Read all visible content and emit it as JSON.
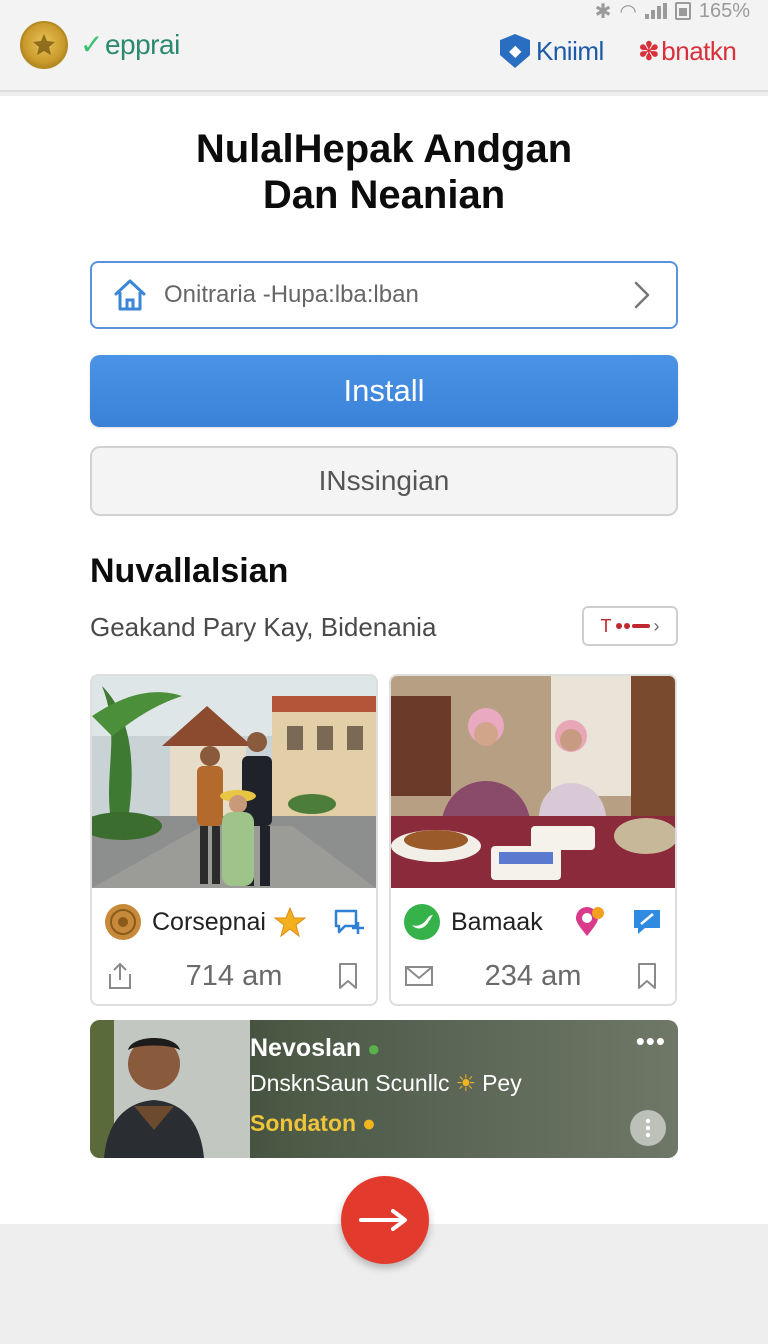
{
  "status_bar": {
    "battery_text": "165%"
  },
  "header": {
    "brand_left": "epprai",
    "brand_right_1": "Kniiml",
    "brand_right_2": "bnatkn"
  },
  "main": {
    "title_line1": "NulalHepak Andgan",
    "title_line2": "Dan Neanian",
    "picker_value": "Onitraria -Hupa:lba:lban",
    "primary_button": "Install",
    "secondary_button": "INssingian",
    "section_title": "Nuvallalsian",
    "subline": "Geakand Pary Kay, Bidenania",
    "tag_text": "T"
  },
  "posts": [
    {
      "name": "Corsepnai",
      "time": "714 am",
      "avatar_icon": "gold-medallion-icon",
      "badge_icon": "star-icon",
      "action_icon": "message-plus-icon",
      "footer_left_icon": "share-icon",
      "footer_right_icon": "bookmark-icon"
    },
    {
      "name": "Bamaak",
      "time": "234 am",
      "avatar_icon": "bird-logo-icon",
      "badge_icon": "location-pin-icon",
      "action_icon": "edit-message-icon",
      "footer_left_icon": "mail-icon",
      "footer_right_icon": "bookmark-icon"
    }
  ],
  "banner": {
    "title": "Nevoslan",
    "subtitle_part1": "DnsknSaun Scunllc",
    "subtitle_part2": "Pey",
    "cta": "Sondaton"
  },
  "colors": {
    "primary": "#3a82d8",
    "fab": "#e23b2e",
    "brand_green": "#2b8a6e",
    "brand_red": "#d8313b",
    "brand_blue": "#1c5aa8"
  }
}
